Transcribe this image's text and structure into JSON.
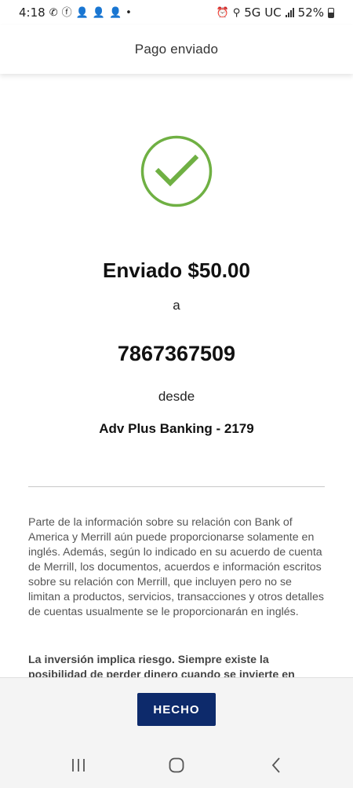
{
  "status_bar": {
    "time": "4:18",
    "network": "5G UC",
    "battery": "52%"
  },
  "header": {
    "title": "Pago enviado"
  },
  "confirmation": {
    "icon": "check-circle-icon",
    "amount_text": "Enviado $50.00",
    "to_label": "a",
    "recipient": "7867367509",
    "from_label": "desde",
    "account": "Adv Plus Banking - 2179"
  },
  "disclaimer": {
    "text": "Parte de la información sobre su relación con Bank of America y Merrill aún puede proporcionarse solamente en inglés. Además, según lo indicado en su acuerdo de cuenta de Merrill, los documentos, acuerdos e información escritos sobre su relación con Merrill, que incluyen pero no se limitan a productos, servicios, transacciones y otros detalles de cuentas usualmente se le proporcionarán en inglés.",
    "risk_text": "La inversión implica riesgo. Siempre existe la posibilidad de perder dinero cuando se invierte en"
  },
  "actions": {
    "done_label": "HECHO"
  },
  "colors": {
    "check_green": "#6fb043",
    "button_navy": "#0d2a6b"
  }
}
